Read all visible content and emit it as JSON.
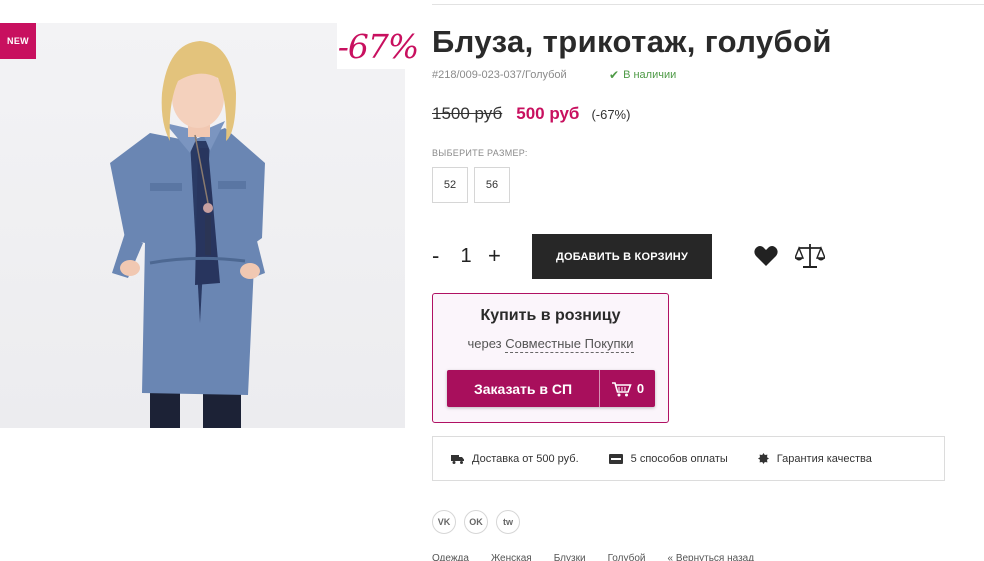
{
  "badges": {
    "new": "NEW",
    "discount": "-67%"
  },
  "product": {
    "title": "Блуза, трикотаж, голубой",
    "sku": "#218/009-023-037/Голубой",
    "stock": "В наличии",
    "price_old": "1500 руб",
    "price_new": "500 руб",
    "discount_pct": "(-67%)"
  },
  "sizes": {
    "label": "ВЫБЕРИТЕ РАЗМЕР:",
    "options": [
      "52",
      "56"
    ]
  },
  "quantity": {
    "minus": "-",
    "value": "1",
    "plus": "+"
  },
  "add_to_cart": "ДОБАВИТЬ В КОРЗИНУ",
  "retail": {
    "title": "Купить в розницу",
    "prefix": "через",
    "link": "Совместные Покупки",
    "order_label": "Заказать в СП",
    "cart_count": "0"
  },
  "features": [
    {
      "icon": "truck-icon",
      "label": "Доставка от 500 руб."
    },
    {
      "icon": "card-icon",
      "label": "5 способов оплаты"
    },
    {
      "icon": "seal-icon",
      "label": "Гарантия качества"
    }
  ],
  "socials": [
    {
      "name": "vk",
      "label": "VK"
    },
    {
      "name": "odnoklassniki",
      "label": "OK"
    },
    {
      "name": "twitter",
      "label": "tw"
    }
  ],
  "breadcrumbs": [
    "Одежда",
    "Женская",
    "Блузки",
    "Голубой",
    "« Вернуться назад"
  ],
  "colors": {
    "accent": "#c8105f",
    "dark_button": "#272727",
    "in_stock": "#4e9a46"
  }
}
